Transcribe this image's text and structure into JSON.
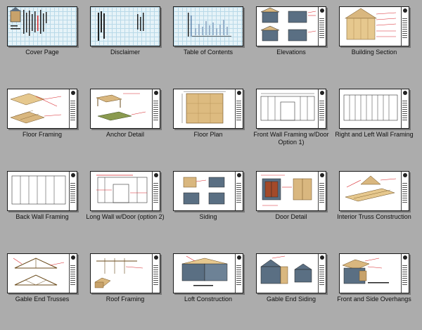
{
  "pages": [
    {
      "label": "Cover Page",
      "icon": "cover-page-thumbnail-icon"
    },
    {
      "label": "Disclaimer",
      "icon": "disclaimer-thumbnail-icon"
    },
    {
      "label": "Table of Contents",
      "icon": "table-of-contents-thumbnail-icon"
    },
    {
      "label": "Elevations",
      "icon": "elevations-thumbnail-icon"
    },
    {
      "label": "Building Section",
      "icon": "building-section-thumbnail-icon"
    },
    {
      "label": "Floor Framing",
      "icon": "floor-framing-thumbnail-icon"
    },
    {
      "label": "Anchor Detail",
      "icon": "anchor-detail-thumbnail-icon"
    },
    {
      "label": "Floor Plan",
      "icon": "floor-plan-thumbnail-icon"
    },
    {
      "label": "Front Wall Framing w/Door Option 1)",
      "icon": "front-wall-framing-thumbnail-icon"
    },
    {
      "label": "Right and Left Wall Framing",
      "icon": "side-wall-framing-thumbnail-icon"
    },
    {
      "label": "Back Wall Framing",
      "icon": "back-wall-framing-thumbnail-icon"
    },
    {
      "label": "Long Wall w/Door (option 2)",
      "icon": "long-wall-door-thumbnail-icon"
    },
    {
      "label": "Siding",
      "icon": "siding-thumbnail-icon"
    },
    {
      "label": "Door Detail",
      "icon": "door-detail-thumbnail-icon"
    },
    {
      "label": "Interior Truss Construction",
      "icon": "interior-truss-thumbnail-icon"
    },
    {
      "label": "Gable End Trusses",
      "icon": "gable-end-trusses-thumbnail-icon"
    },
    {
      "label": "Roof Framing",
      "icon": "roof-framing-thumbnail-icon"
    },
    {
      "label": "Loft Construction",
      "icon": "loft-construction-thumbnail-icon"
    },
    {
      "label": "Gable End Siding",
      "icon": "gable-end-siding-thumbnail-icon"
    },
    {
      "label": "Front and Side Overhangs",
      "icon": "front-side-overhangs-thumbnail-icon"
    }
  ],
  "colors": {
    "background": "#acacac",
    "wood": "#d9b77f",
    "siding": "#5a6f83",
    "annotation": "#d8262b"
  }
}
